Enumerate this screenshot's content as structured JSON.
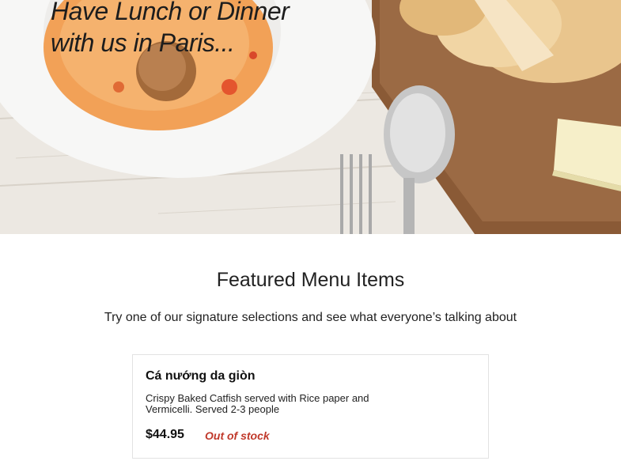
{
  "hero": {
    "heading_line1": "Have Lunch or Dinner",
    "heading_line2": "with us in Paris..."
  },
  "featured": {
    "title": "Featured Menu Items",
    "subtitle": "Try one of our signature selections and see what everyone’s talking about",
    "items": [
      {
        "name": "Cá nướng da giòn",
        "description": "Crispy Baked Catfish served with Rice paper and Vermicelli. Served 2-3 people",
        "price": "$44.95",
        "stock_status": "Out of stock"
      }
    ]
  },
  "colors": {
    "out_of_stock": "#c0392b",
    "card_border": "#e2e2e2"
  }
}
